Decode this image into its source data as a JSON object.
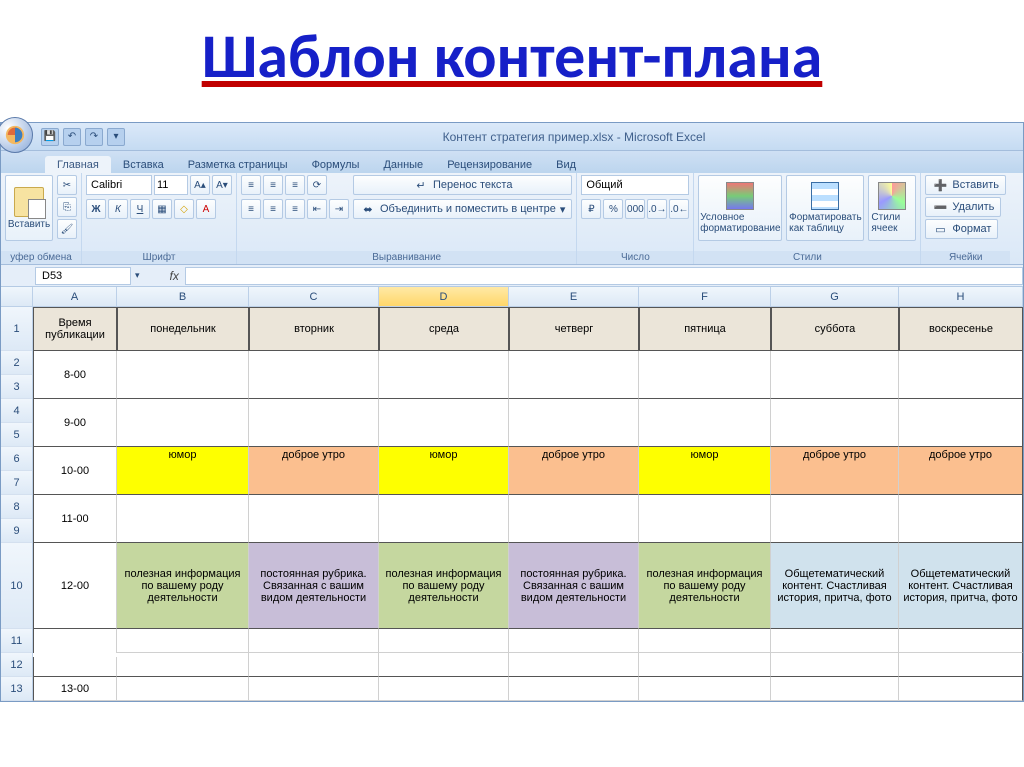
{
  "page_title": "Шаблон контент-плана",
  "window_title": "Контент стратегия пример.xlsx - Microsoft Excel",
  "ribbon": {
    "tabs": [
      "Главная",
      "Вставка",
      "Разметка страницы",
      "Формулы",
      "Данные",
      "Рецензирование",
      "Вид"
    ],
    "active_tab": 0,
    "clipboard": {
      "paste": "Вставить",
      "label": "уфер обмена"
    },
    "font": {
      "name": "Calibri",
      "size": "11",
      "label": "Шрифт"
    },
    "alignment": {
      "wrap": "Перенос текста",
      "merge": "Объединить и поместить в центре",
      "label": "Выравнивание"
    },
    "number": {
      "format": "Общий",
      "label": "Число"
    },
    "styles": {
      "cond": "Условное форматирование",
      "astable": "Форматировать как таблицу",
      "cellstyles": "Стили ячеек",
      "label": "Стили"
    },
    "cells": {
      "insert": "Вставить",
      "delete": "Удалить",
      "format": "Формат",
      "label": "Ячейки"
    }
  },
  "namebox": "D53",
  "columns": [
    "A",
    "B",
    "C",
    "D",
    "E",
    "F",
    "G",
    "H"
  ],
  "selected_col": 3,
  "rownums_left": [
    "1",
    "2",
    "3",
    "4",
    "5",
    "6",
    "7",
    "8",
    "9",
    "10",
    "11",
    "12",
    "13"
  ],
  "table": {
    "headers": [
      "Время публикации",
      "понедельник",
      "вторник",
      "среда",
      "четверг",
      "пятница",
      "суббота",
      "воскресенье"
    ],
    "rows": [
      {
        "time": "8-00",
        "cells": [
          "",
          "",
          "",
          "",
          "",
          "",
          ""
        ]
      },
      {
        "time": "9-00",
        "cells": [
          "",
          "",
          "",
          "",
          "",
          "",
          ""
        ]
      },
      {
        "time": "10-00",
        "cells": [
          "юмор",
          "доброе утро",
          "юмор",
          "доброе утро",
          "юмор",
          "доброе утро",
          "доброе утро"
        ],
        "colors": [
          "yellow",
          "salmon",
          "yellow",
          "salmon",
          "yellow",
          "salmon",
          "salmon"
        ]
      },
      {
        "time": "11-00",
        "cells": [
          "",
          "",
          "",
          "",
          "",
          "",
          ""
        ]
      },
      {
        "time": "12-00",
        "cells": [
          "полезная информация по вашему роду деятельности",
          "постоянная рубрика. Связанная с вашим видом деятельности",
          "полезная информация по вашему роду деятельности",
          "постоянная рубрика. Связанная с вашим видом деятельности",
          "полезная информация по вашему роду деятельности",
          "Общетематический контент. Счастливая история, притча, фото",
          "Общетематический контент. Счастливая история, притча, фото"
        ],
        "colors": [
          "olive",
          "violet",
          "olive",
          "violet",
          "olive",
          "lblue",
          "lblue"
        ]
      },
      {
        "time": "13-00",
        "cells": [
          "",
          "",
          "",
          "",
          "",
          "",
          ""
        ]
      }
    ]
  }
}
